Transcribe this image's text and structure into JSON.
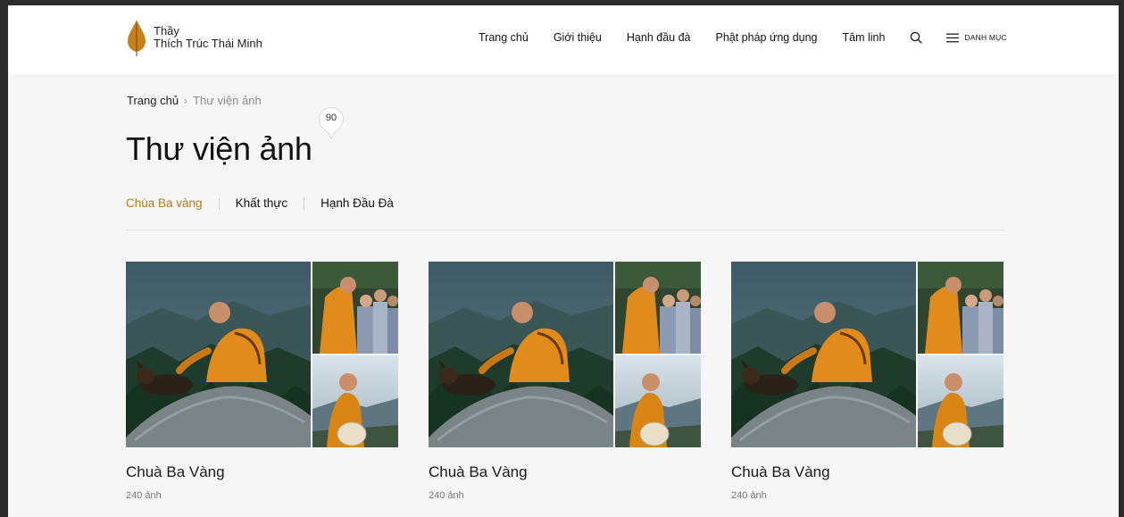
{
  "logo": {
    "line1": "Thầy",
    "line2": "Thích Trúc Thái Minh"
  },
  "nav": {
    "items": [
      "Trang chủ",
      "Giới thiệu",
      "Hạnh đầu đà",
      "Phật pháp ứng dụng",
      "Tâm linh"
    ],
    "menu_label": "DANH MỤC"
  },
  "breadcrumb": {
    "home": "Trang chủ",
    "current": "Thư viện ảnh"
  },
  "page": {
    "title": "Thư viện ảnh",
    "count": "90"
  },
  "tabs": [
    "Chùa Ba vàng",
    "Khất thực",
    "Hạnh Đầu Đà"
  ],
  "albums": [
    {
      "title": "Chuà Ba Vàng",
      "count": "240 ảnh"
    },
    {
      "title": "Chuà Ba Vàng",
      "count": "240 ảnh"
    },
    {
      "title": "Chuà Ba Vàng",
      "count": "240 ảnh"
    }
  ],
  "colors": {
    "accent": "#b07a1c",
    "robe": "#e08b1c",
    "text": "#1a1a1a"
  }
}
